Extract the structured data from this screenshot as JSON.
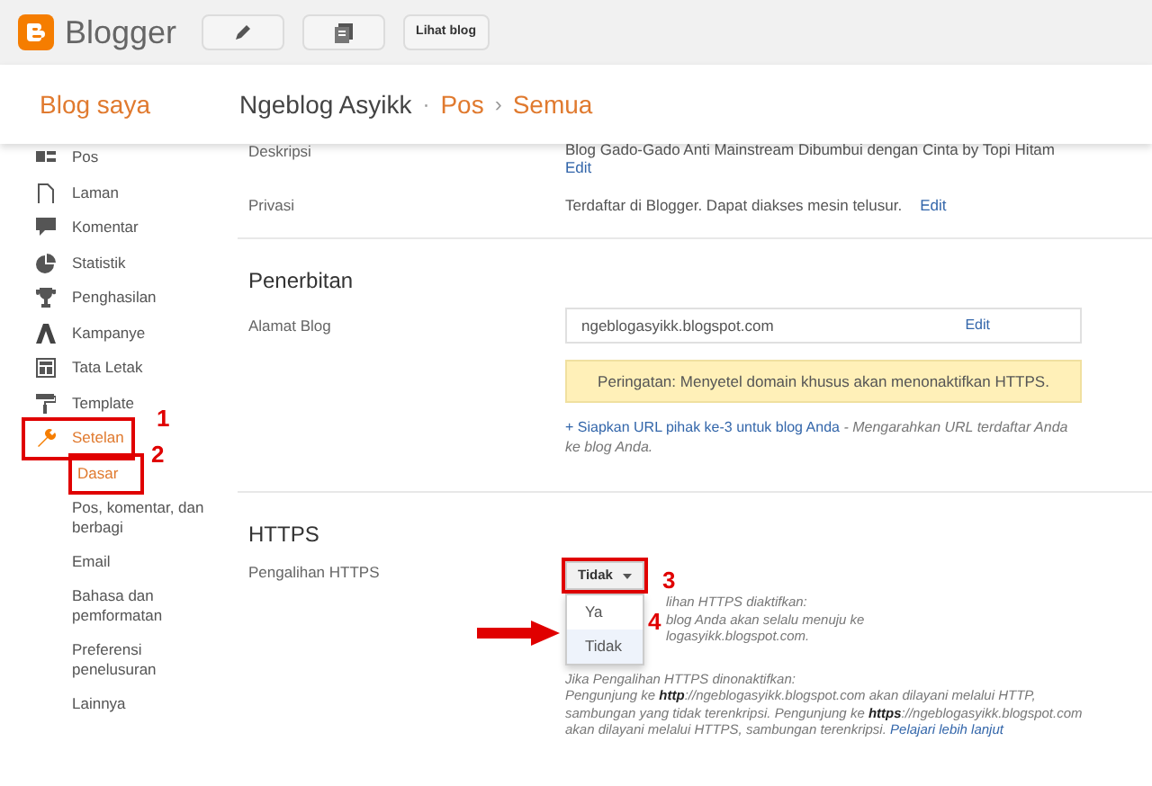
{
  "topbar": {
    "logo_text": "Blogger",
    "view_button": "Lihat blog"
  },
  "header": {
    "title": "Blog saya",
    "breadcrumb": [
      {
        "label": "Ngeblog Asyikk",
        "kind": "blog"
      },
      {
        "label": "Pos",
        "kind": "link",
        "separator": "·"
      },
      {
        "label": "Semua",
        "kind": "link",
        "separator": "›"
      }
    ]
  },
  "sidebar": {
    "items": [
      {
        "label": "Pos",
        "selected": false,
        "highlighted": false
      },
      {
        "label": "Laman",
        "selected": false,
        "highlighted": false
      },
      {
        "label": "Komentar",
        "selected": false,
        "highlighted": false
      },
      {
        "label": "Statistik",
        "selected": false,
        "highlighted": false
      },
      {
        "label": "Penghasilan",
        "selected": false,
        "highlighted": false
      },
      {
        "label": "Kampanye",
        "selected": false,
        "highlighted": false
      },
      {
        "label": "Tata Letak",
        "selected": false,
        "highlighted": false
      },
      {
        "label": "Template",
        "selected": false,
        "highlighted": false
      },
      {
        "label": "Setelan",
        "selected": true,
        "highlighted": true,
        "children": [
          {
            "label": "Dasar",
            "selected": true,
            "highlighted": true
          },
          {
            "label": "Pos, komentar, dan berbagi",
            "selected": false,
            "highlighted": false
          },
          {
            "label": "Email",
            "selected": false,
            "highlighted": false
          },
          {
            "label": "Bahasa dan pemformatan",
            "selected": false,
            "highlighted": false
          },
          {
            "label": "Preferensi penelusuran",
            "selected": false,
            "highlighted": false
          },
          {
            "label": "Lainnya",
            "selected": false,
            "highlighted": false
          }
        ]
      }
    ]
  },
  "settings": {
    "description": {
      "label": "Deskripsi",
      "value": "Blog Gado-Gado Anti Mainstream Dibumbui dengan Cinta by Topi Hitam",
      "edit": "Edit"
    },
    "privacy": {
      "label": "Privasi",
      "value": "Terdaftar di Blogger. Dapat diakses mesin telusur.",
      "edit": "Edit"
    },
    "publishing": {
      "title": "Penerbitan",
      "address_label": "Alamat Blog",
      "address_value": "ngeblogasyikk.blogspot.com",
      "edit": "Edit",
      "warning": "Peringatan: Menyetel domain khusus akan menonaktifkan HTTPS.",
      "third_party_link": "+ Siapkan URL pihak ke-3 untuk blog Anda",
      "third_party_note": "- Mengarahkan URL terdaftar Anda ke blog Anda."
    },
    "https": {
      "title": "HTTPS",
      "redirect_label": "Pengalihan HTTPS",
      "dropdown": {
        "value": "Tidak",
        "highlighted": true,
        "expanded": true,
        "options": [
          {
            "label": "Ya",
            "selected": false
          },
          {
            "label": "Tidak",
            "selected": true
          }
        ]
      },
      "covered_lines": [
        "lihan HTTPS diaktifkan:",
        "blog Anda akan selalu menuju ke",
        "logasyikk.blogspot.com."
      ],
      "disabled_title": "Jika Pengalihan HTTPS dinonaktifkan:",
      "disabled_text": "Pengunjung ke **http**://ngeblogasyikk.blogspot.com akan dilayani melalui HTTP, sambungan yang tidak terenkripsi. Pengunjung ke **https**://ngeblogasyikk.blogspot.com akan dilayani melalui HTTPS, sambungan terenkripsi.",
      "learn_more": "Pelajari lebih lanjut"
    }
  },
  "annotations": [
    {
      "label": "1"
    },
    {
      "label": "2"
    },
    {
      "label": "3"
    },
    {
      "label": "4"
    }
  ]
}
